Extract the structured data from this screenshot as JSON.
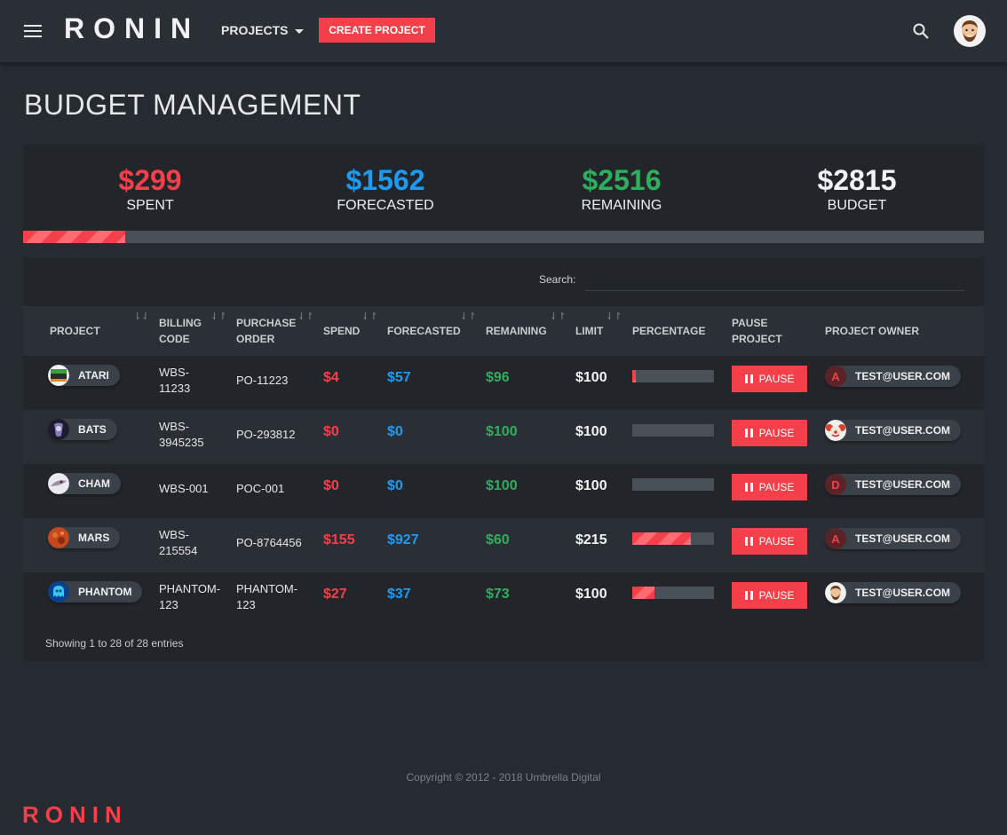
{
  "nav": {
    "logo": "RONIN",
    "projects_label": "PROJECTS",
    "create_label": "CREATE PROJECT"
  },
  "page": {
    "title": "BUDGET MANAGEMENT"
  },
  "summary": {
    "spent": {
      "value": "$299",
      "label": "SPENT"
    },
    "forecasted": {
      "value": "$1562",
      "label": "FORECASTED"
    },
    "remaining": {
      "value": "$2516",
      "label": "REMAINING"
    },
    "budget": {
      "value": "$2815",
      "label": "BUDGET"
    },
    "progress_fraction": 0.106
  },
  "table": {
    "search_label": "Search:",
    "search_value": "",
    "headers": {
      "project": "PROJECT",
      "billing_1": "BILLING",
      "billing_2": "CODE",
      "purchase_1": "PURCHASE",
      "purchase_2": "ORDER",
      "spend": "SPEND",
      "forecasted": "FORECASTED",
      "remaining": "REMAINING",
      "limit": "LIMIT",
      "percentage": "PERCENTAGE",
      "pause_1": "PAUSE",
      "pause_2": "PROJECT",
      "owner": "PROJECT OWNER"
    },
    "rows": [
      {
        "project": "ATARI",
        "icon": "atari",
        "billing_1": "WBS-",
        "billing_2": "11233",
        "po_1": "PO-11223",
        "po_2": "",
        "spend": "$4",
        "forecasted": "$57",
        "remaining": "$96",
        "limit": "$100",
        "pct": 0.04,
        "pause": "PAUSE",
        "owner": "TEST@USER.COM",
        "owner_avatar": "A",
        "owner_kind": "letter"
      },
      {
        "project": "BATS",
        "icon": "bats",
        "billing_1": "WBS-",
        "billing_2": "3945235",
        "po_1": "PO-293812",
        "po_2": "",
        "spend": "$0",
        "forecasted": "$0",
        "remaining": "$100",
        "limit": "$100",
        "pct": 0,
        "pause": "PAUSE",
        "owner": "TEST@USER.COM",
        "owner_avatar": "",
        "owner_kind": "clown"
      },
      {
        "project": "CHAM",
        "icon": "cham",
        "billing_1": "WBS-001",
        "billing_2": "",
        "po_1": "POC-001",
        "po_2": "",
        "spend": "$0",
        "forecasted": "$0",
        "remaining": "$100",
        "limit": "$100",
        "pct": 0,
        "pause": "PAUSE",
        "owner": "TEST@USER.COM",
        "owner_avatar": "D",
        "owner_kind": "letter"
      },
      {
        "project": "MARS",
        "icon": "mars",
        "billing_1": "WBS-",
        "billing_2": "215554",
        "po_1": "PO-8764456",
        "po_2": "",
        "spend": "$155",
        "forecasted": "$927",
        "remaining": "$60",
        "limit": "$215",
        "pct": 0.72,
        "pause": "PAUSE",
        "owner": "TEST@USER.COM",
        "owner_avatar": "A",
        "owner_kind": "letter"
      },
      {
        "project": "PHANTOM",
        "icon": "phantom",
        "billing_1": "PHANTOM-",
        "billing_2": "123",
        "po_1": "PHANTOM-",
        "po_2": "123",
        "spend": "$27",
        "forecasted": "$37",
        "remaining": "$73",
        "limit": "$100",
        "pct": 0.27,
        "pause": "PAUSE",
        "owner": "TEST@USER.COM",
        "owner_avatar": "",
        "owner_kind": "face"
      }
    ],
    "showing": "Showing 1 to 28 of 28 entries"
  },
  "footer": {
    "copyright": "Copyright © 2012 - 2018 Umbrella Digital",
    "logo": "RONIN"
  },
  "colors": {
    "accent_red": "#f4404a",
    "blue": "#1e9af0",
    "green": "#2fae5e",
    "background": "#262b31"
  },
  "icons": [
    "menu-icon",
    "search-icon",
    "user-avatar",
    "caret-down-icon",
    "pause-icon",
    "sort-icon"
  ]
}
